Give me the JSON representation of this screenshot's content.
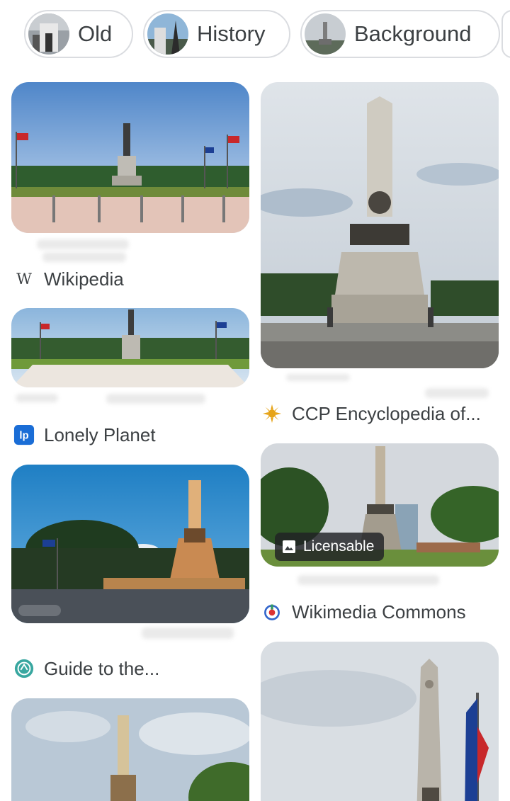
{
  "chips": [
    {
      "label": "Old",
      "icon": "old-photo-thumbnail"
    },
    {
      "label": "History",
      "icon": "history-photo-thumbnail"
    },
    {
      "label": "Background",
      "icon": "background-photo-thumbnail"
    }
  ],
  "results": {
    "left": [
      {
        "source": "Wikipedia",
        "icon": "wikipedia-w-icon"
      },
      {
        "source": "Lonely Planet",
        "icon": "lonely-planet-lp-icon"
      },
      {
        "source": "Guide to the...",
        "icon": "guide-globe-icon"
      }
    ],
    "right": [
      {
        "source": "CCP Encyclopedia of...",
        "icon": "ccp-sun-icon"
      },
      {
        "source": "Wikimedia Commons",
        "icon": "wikimedia-icon",
        "badge": "Licensable"
      }
    ]
  },
  "colors": {
    "chip_border": "#dadce0",
    "text": "#3c4043",
    "badge_bg": "#202124",
    "lp_blue": "#1a6dd6",
    "guide_teal": "#39a7a0",
    "ccp_gold": "#e6a317",
    "wikimedia_red": "#d33",
    "wikimedia_blue": "#36c"
  }
}
